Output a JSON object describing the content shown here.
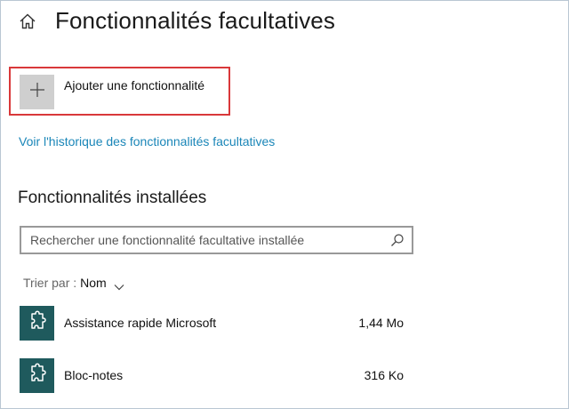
{
  "header": {
    "title": "Fonctionnalités facultatives",
    "home_icon": "home-icon"
  },
  "add_feature": {
    "label": "Ajouter une fonctionnalité",
    "icon": "plus-icon",
    "highlight_color": "#d9383a"
  },
  "history_link": {
    "label": "Voir l'historique des fonctionnalités facultatives",
    "color": "#1a86b8"
  },
  "installed": {
    "title": "Fonctionnalités installées",
    "search": {
      "placeholder": "Rechercher une fonctionnalité facultative installée",
      "value": "",
      "icon": "search-icon"
    },
    "sort": {
      "prefix": "Trier par :",
      "value": "Nom",
      "icon": "chevron-down-icon"
    },
    "items": [
      {
        "name": "Assistance rapide Microsoft",
        "size": "1,44 Mo",
        "icon": "puzzle-icon"
      },
      {
        "name": "Bloc-notes",
        "size": "316 Ko",
        "icon": "puzzle-icon"
      }
    ]
  },
  "colors": {
    "tile_accent": "#1f5a5d",
    "add_tile": "#cfcfcf"
  }
}
